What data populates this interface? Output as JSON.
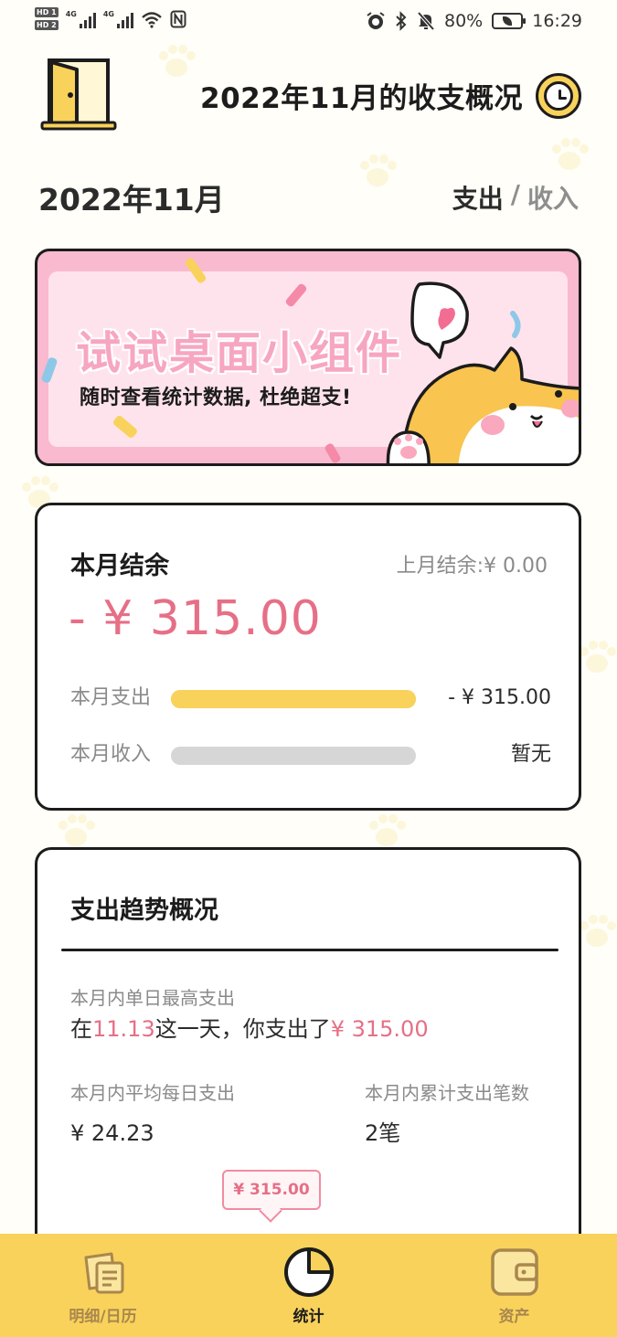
{
  "status_bar": {
    "hd_badges": [
      "HD 1",
      "HD 2"
    ],
    "network": [
      "4G",
      "4G"
    ],
    "battery_percent": "80%",
    "time": "16:29",
    "icons": [
      "alarm-icon",
      "bluetooth-icon",
      "mute-icon",
      "battery-icon",
      "wifi-icon",
      "nfc-icon"
    ]
  },
  "header": {
    "title": "2022年11月的收支概况",
    "month": "2022年11月",
    "toggle": {
      "expense": "支出",
      "separator": "/",
      "income": "收入",
      "active": "expense"
    }
  },
  "banner": {
    "title": "试试桌面小组件",
    "subtitle": "随时查看统计数据, 杜绝超支!"
  },
  "balance": {
    "title": "本月结余",
    "last_month_label": "上月结余:",
    "last_month_value": "¥ 0.00",
    "amount": "- ¥ 315.00",
    "rows": [
      {
        "label": "本月支出",
        "value": "- ¥ 315.00",
        "fill": 1.0
      },
      {
        "label": "本月收入",
        "value": "暂无",
        "fill": 0.0
      }
    ]
  },
  "trend": {
    "title": "支出趋势概况",
    "max_day_label": "本月内单日最高支出",
    "max_day_prefix": "在",
    "max_day_date": "11.13",
    "max_day_middle": "这一天，你支出了",
    "max_day_amount": "¥ 315.00",
    "avg_label": "本月内平均每日支出",
    "avg_value": "¥ 24.23",
    "count_label": "本月内累计支出笔数",
    "count_value": "2笔",
    "tooltip": "¥ 315.00"
  },
  "bottom_nav": [
    {
      "label": "明细/日历",
      "icon": "document-icon",
      "active": false
    },
    {
      "label": "统计",
      "icon": "pie-chart-icon",
      "active": true
    },
    {
      "label": "资产",
      "icon": "wallet-icon",
      "active": false
    }
  ],
  "colors": {
    "accent_yellow": "#f9d25b",
    "accent_pink": "#e66f86",
    "banner_pink": "#f9b9cf"
  }
}
